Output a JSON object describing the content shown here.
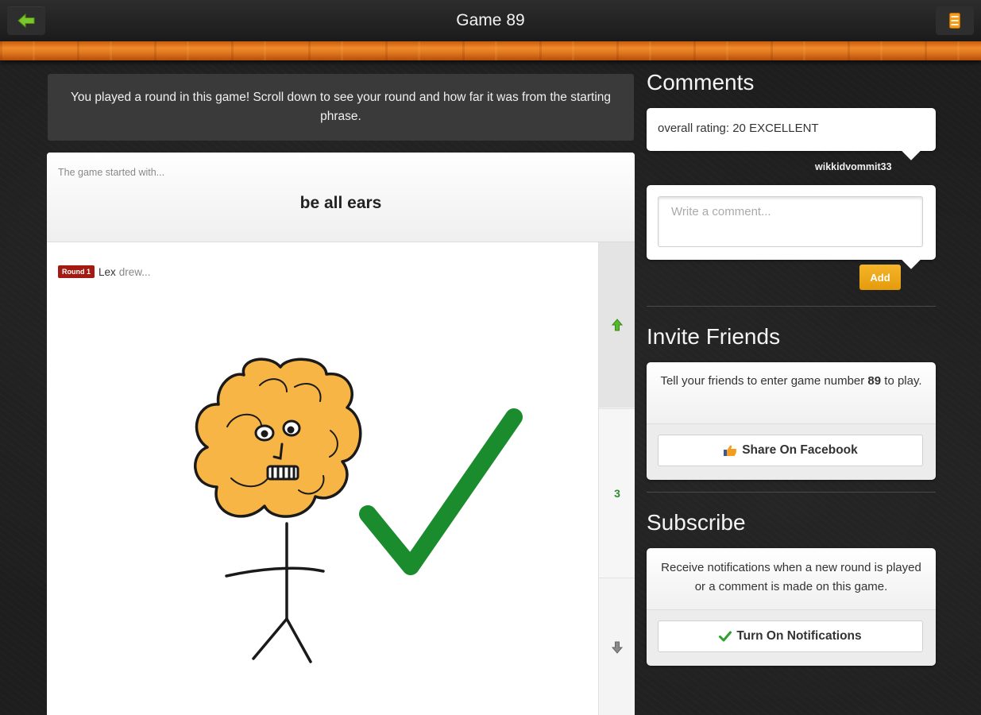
{
  "header": {
    "title": "Game 89"
  },
  "notice": {
    "text": "You played a round in this game! Scroll down to see your round and how far it was from the starting phrase."
  },
  "game": {
    "started_label": "The game started with...",
    "starting_phrase": "be all ears",
    "round": {
      "badge": "Round 1",
      "player": "Lex",
      "action": "drew..."
    },
    "rail_count": "3"
  },
  "comments": {
    "title": "Comments",
    "items": [
      {
        "text": "overall rating: 20 EXCELLENT",
        "author": "wikkidvommit33"
      }
    ],
    "input_placeholder": "Write a comment...",
    "add_label": "Add"
  },
  "invite": {
    "title": "Invite Friends",
    "text_before": "Tell your friends to enter game number",
    "game_number": "89",
    "text_after": "to play.",
    "share_label": "Share On Facebook"
  },
  "subscribe": {
    "title": "Subscribe",
    "text": "Receive notifications when a new round is played or a comment is made on this game.",
    "button_label": "Turn On Notifications"
  },
  "colors": {
    "accent_orange": "#f0a81c",
    "wood": "#e07821",
    "round_badge": "#a21a12",
    "vote_green": "#2e8a2e",
    "check_green": "#1a8c2e"
  }
}
